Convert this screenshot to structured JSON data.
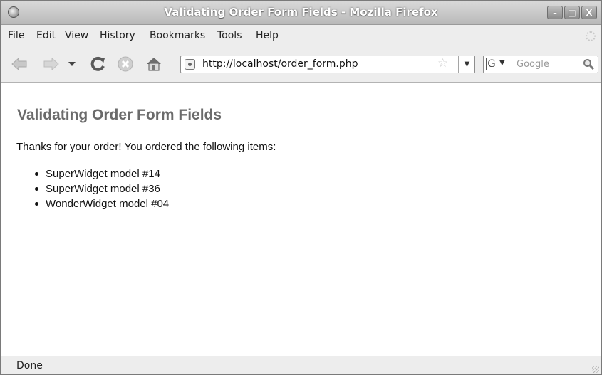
{
  "window": {
    "title": "Validating Order Form Fields - Mozilla Firefox",
    "buttons": {
      "minimize": "–",
      "maximize": "□",
      "close": "X"
    }
  },
  "menu": {
    "items": [
      {
        "label": "File"
      },
      {
        "label": "Edit"
      },
      {
        "label": "View"
      },
      {
        "label": "History"
      },
      {
        "label": "Bookmarks"
      },
      {
        "label": "Tools"
      },
      {
        "label": "Help"
      }
    ]
  },
  "navigation": {
    "url": "http://localhost/order_form.php",
    "search_placeholder": "Google",
    "search_engine_letter": "G",
    "icons": [
      "back-arrow-icon",
      "forward-arrow-icon",
      "history-dropdown-icon",
      "reload-icon",
      "stop-icon",
      "home-icon",
      "site-identity-icon",
      "bookmark-star-icon",
      "url-history-dropdown-icon",
      "search-engine-icon",
      "magnifier-icon"
    ]
  },
  "page": {
    "heading": "Validating Order Form Fields",
    "intro": "Thanks for your order! You ordered the following items:",
    "items": [
      "SuperWidget model #14",
      "SuperWidget model #36",
      "WonderWidget model #04"
    ]
  },
  "status": {
    "text": "Done"
  },
  "colors": {
    "heading": "#6b6b6b",
    "chrome": "#ededed",
    "titlebar_text": "#ffffff"
  }
}
